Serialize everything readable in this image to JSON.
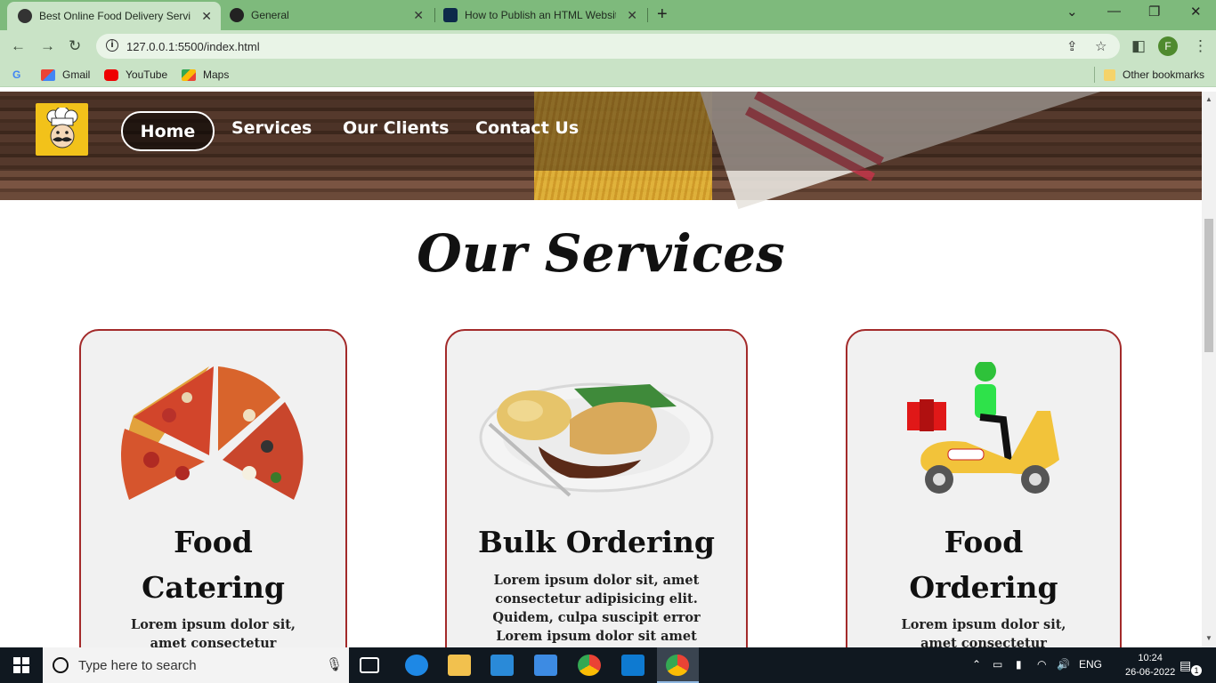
{
  "browser": {
    "tabs": [
      {
        "label": "Best Online Food Delivery Service",
        "active": true
      },
      {
        "label": "General",
        "active": false
      },
      {
        "label": "How to Publish an HTML Website",
        "active": false
      }
    ],
    "address": "127.0.0.1:5500/index.html",
    "profile_initial": "F",
    "bookmarks": [
      "Gmail",
      "YouTube",
      "Maps"
    ],
    "other_bookmarks": "Other bookmarks"
  },
  "site": {
    "nav": [
      "Home",
      "Services",
      "Our Clients",
      "Contact Us"
    ],
    "section_title": "Our Services",
    "cards": [
      {
        "title": "Food Catering",
        "text": "Lorem ipsum dolor sit, amet consectetur adipisicing elit."
      },
      {
        "title": "Bulk Ordering",
        "text": "Lorem ipsum dolor sit, amet consectetur adipisicing elit. Quidem, culpa suscipit error Lorem ipsum dolor sit amet consectetur"
      },
      {
        "title": "Food Ordering",
        "text": "Lorem ipsum dolor sit, amet consectetur adipisicing elit."
      }
    ]
  },
  "taskbar": {
    "search_placeholder": "Type here to search",
    "lang": "ENG",
    "time": "10:24",
    "date": "26-06-2022",
    "notification_count": "1"
  },
  "colors": {
    "card_border": "#a32a2a",
    "logo_bg": "#f2c21a",
    "chrome": "#7eba7c"
  }
}
